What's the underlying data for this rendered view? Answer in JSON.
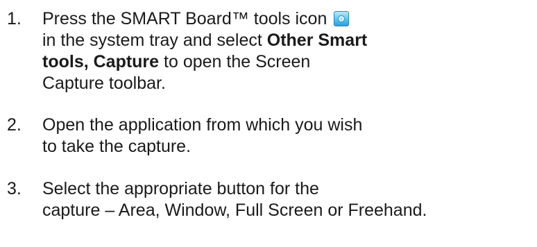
{
  "steps": [
    {
      "number": "1.",
      "line1_text": "Press the SMART Board™ tools icon",
      "icon": "smart-board-tools-icon",
      "line2_bold": "Other Smart",
      "line2_prefix": "in the system tray and select ",
      "line3_bold": "tools, Capture",
      "line3_rest": " to open the Screen",
      "line4": "Capture toolbar."
    },
    {
      "number": "2.",
      "line1": "Open the application from which you wish",
      "line2": "to take the capture."
    },
    {
      "number": "3.",
      "line1": "Select the appropriate button for the",
      "line2": "capture – Area, Window, Full Screen or Freehand."
    }
  ],
  "colors": {
    "text": "#1a1a1a",
    "icon_fill": "#5dc3ee",
    "icon_border": "#1f86c2"
  }
}
